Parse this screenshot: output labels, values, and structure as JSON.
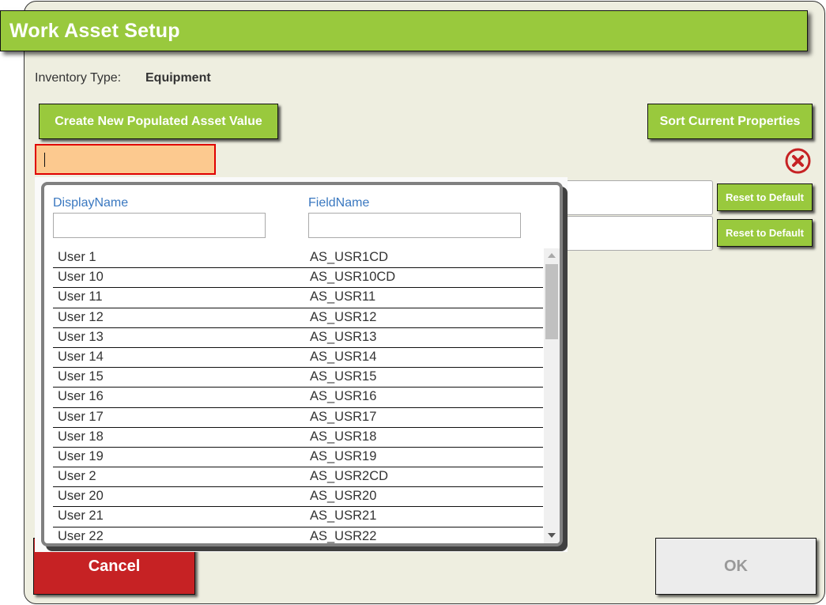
{
  "window": {
    "title": "Work Asset Setup"
  },
  "inventory": {
    "label": "Inventory Type:",
    "value": "Equipment"
  },
  "toolbar": {
    "create_label": "Create New Populated Asset Value",
    "sort_label": "Sort Current Properties"
  },
  "search": {
    "value": "",
    "placeholder": ""
  },
  "properties": [
    {
      "value": "",
      "reset_label": "Reset to Default"
    },
    {
      "value": "",
      "reset_label": "Reset to Default"
    }
  ],
  "popup": {
    "columns": [
      {
        "header": "DisplayName",
        "filter_value": ""
      },
      {
        "header": "FieldName",
        "filter_value": ""
      }
    ],
    "rows": [
      {
        "display": "User 1",
        "field": "AS_USR1CD"
      },
      {
        "display": "User 10",
        "field": "AS_USR10CD"
      },
      {
        "display": "User 11",
        "field": "AS_USR11"
      },
      {
        "display": "User 12",
        "field": "AS_USR12"
      },
      {
        "display": "User 13",
        "field": "AS_USR13"
      },
      {
        "display": "User 14",
        "field": "AS_USR14"
      },
      {
        "display": "User 15",
        "field": "AS_USR15"
      },
      {
        "display": "User 16",
        "field": "AS_USR16"
      },
      {
        "display": "User 17",
        "field": "AS_USR17"
      },
      {
        "display": "User 18",
        "field": "AS_USR18"
      },
      {
        "display": "User 19",
        "field": "AS_USR19"
      },
      {
        "display": "User 2",
        "field": "AS_USR2CD"
      },
      {
        "display": "User 20",
        "field": "AS_USR20"
      },
      {
        "display": "User 21",
        "field": "AS_USR21"
      },
      {
        "display": "User 22",
        "field": "AS_USR22"
      }
    ]
  },
  "footer": {
    "cancel_label": "Cancel",
    "ok_label": "OK"
  },
  "colors": {
    "accent_green": "#99c93d",
    "cancel_red": "#c62224",
    "search_fill": "#fcc98f",
    "search_border": "#e00000",
    "header_blue": "#3a78c0",
    "background": "#eeeee0"
  }
}
